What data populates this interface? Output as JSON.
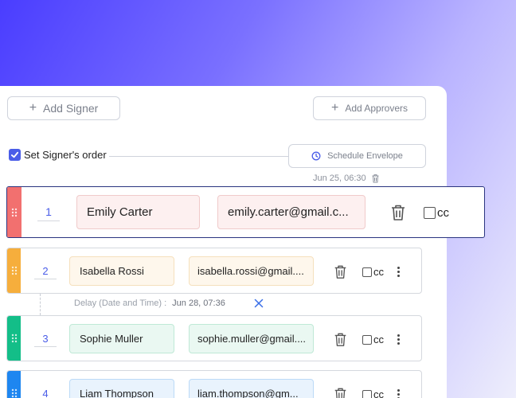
{
  "toolbar": {
    "add_signer_label": "Add Signer",
    "add_approvers_label": "Add Approvers"
  },
  "order": {
    "label": "Set Signer's order",
    "checked": true
  },
  "schedule": {
    "label": "Schedule Envelope",
    "timestamp": "Jun 25, 06:30"
  },
  "signers": [
    {
      "number": "1",
      "name": "Emily Carter",
      "email": "emily.carter@gmail.c...",
      "cc_label": "cc",
      "stripe_color": "#f2706f"
    },
    {
      "number": "2",
      "name": "Isabella Rossi",
      "email": "isabella.rossi@gmail....",
      "cc_label": "cc",
      "stripe_color": "#f6ae3c"
    },
    {
      "number": "3",
      "name": "Sophie Muller",
      "email": "sophie.muller@gmail....",
      "cc_label": "cc",
      "stripe_color": "#13be88"
    },
    {
      "number": "4",
      "name": "Liam Thompson",
      "email": "liam.thompson@gm...",
      "cc_label": "cc",
      "stripe_color": "#1e86f0"
    }
  ],
  "delay": {
    "label": "Delay (Date and Time) :",
    "value": "Jun 28, 07:36"
  },
  "colors": {
    "accent": "#4a5de8",
    "name_field_1": "#fdf0f0",
    "name_field_2": "#fef7ec",
    "name_field_3": "#eaf8f2",
    "name_field_4": "#e9f3fd"
  },
  "icons": {
    "plus": "plus-icon",
    "clock": "clock-icon",
    "trash": "trash-icon",
    "drag": "drag-handle-icon",
    "more": "more-vertical-icon",
    "close": "close-icon"
  }
}
